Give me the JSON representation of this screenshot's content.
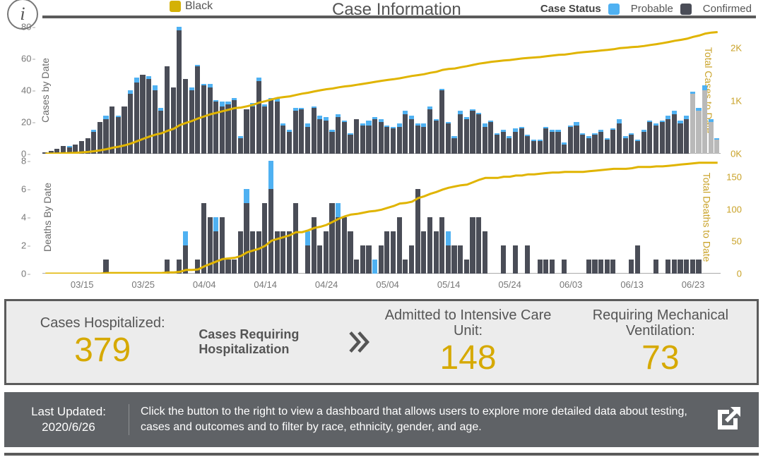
{
  "header": {
    "title": "Case Information",
    "black_label": "Black",
    "status_label": "Case Status",
    "probable": "Probable",
    "confirmed": "Confirmed"
  },
  "hosp": {
    "cases_label": "Cases Hospitalized:",
    "cases_value": "379",
    "note": "Cases Requiring Hospitalization",
    "icu_label": "Admitted to Intensive Care Unit:",
    "icu_value": "148",
    "vent_label": "Requiring Mechanical Ventilation:",
    "vent_value": "73"
  },
  "footer": {
    "lu_label": "Last Updated:",
    "lu_value": "2020/6/26",
    "text": "Click the button to the right to view a dashboard that allows users to explore more detailed data about testing, cases and outcomes and to filter by race, ethnicity, gender, and age."
  },
  "chart_data": [
    {
      "id": "cases",
      "type": "bar+line",
      "left_axis_label": "Cases by Date",
      "right_axis_label": "Total Cases to Date",
      "left_max": 80,
      "left_ticks": [
        0,
        20,
        40,
        60,
        80
      ],
      "right_max": 2400,
      "right_ticks": [
        {
          "v": 0,
          "l": "0K"
        },
        {
          "v": 1000,
          "l": "1K"
        },
        {
          "v": 2000,
          "l": "2K"
        }
      ],
      "x_ticks": [
        "03/15",
        "03/25",
        "04/04",
        "04/14",
        "04/24",
        "05/04",
        "05/14",
        "05/24",
        "06/03",
        "06/13",
        "06/23"
      ],
      "start_date": "2020-03-09",
      "bars": [
        {
          "c": 1,
          "p": 0
        },
        {
          "c": 2,
          "p": 0
        },
        {
          "c": 3,
          "p": 0
        },
        {
          "c": 5,
          "p": 0
        },
        {
          "c": 4,
          "p": 1
        },
        {
          "c": 6,
          "p": 0
        },
        {
          "c": 8,
          "p": 0
        },
        {
          "c": 10,
          "p": 0
        },
        {
          "c": 14,
          "p": 1
        },
        {
          "c": 20,
          "p": 0
        },
        {
          "c": 22,
          "p": 2
        },
        {
          "c": 30,
          "p": 0
        },
        {
          "c": 23,
          "p": 1
        },
        {
          "c": 30,
          "p": 0
        },
        {
          "c": 38,
          "p": 2
        },
        {
          "c": 45,
          "p": 3
        },
        {
          "c": 50,
          "p": 0
        },
        {
          "c": 47,
          "p": 2
        },
        {
          "c": 40,
          "p": 3
        },
        {
          "c": 27,
          "p": 2
        },
        {
          "c": 55,
          "p": 0
        },
        {
          "c": 42,
          "p": 0
        },
        {
          "c": 78,
          "p": 2
        },
        {
          "c": 47,
          "p": 0
        },
        {
          "c": 40,
          "p": 2
        },
        {
          "c": 55,
          "p": 1
        },
        {
          "c": 43,
          "p": 1
        },
        {
          "c": 42,
          "p": 2
        },
        {
          "c": 33,
          "p": 1
        },
        {
          "c": 30,
          "p": 3
        },
        {
          "c": 31,
          "p": 2
        },
        {
          "c": 34,
          "p": 1
        },
        {
          "c": 10,
          "p": 1
        },
        {
          "c": 28,
          "p": 0
        },
        {
          "c": 30,
          "p": 2
        },
        {
          "c": 46,
          "p": 2
        },
        {
          "c": 30,
          "p": 1
        },
        {
          "c": 34,
          "p": 1
        },
        {
          "c": 33,
          "p": 2
        },
        {
          "c": 18,
          "p": 1
        },
        {
          "c": 14,
          "p": 1
        },
        {
          "c": 27,
          "p": 2
        },
        {
          "c": 28,
          "p": 1
        },
        {
          "c": 17,
          "p": 2
        },
        {
          "c": 29,
          "p": 1
        },
        {
          "c": 22,
          "p": 2
        },
        {
          "c": 21,
          "p": 2
        },
        {
          "c": 14,
          "p": 1
        },
        {
          "c": 23,
          "p": 2
        },
        {
          "c": 20,
          "p": 1
        },
        {
          "c": 12,
          "p": 1
        },
        {
          "c": 22,
          "p": 0
        },
        {
          "c": 18,
          "p": 1
        },
        {
          "c": 18,
          "p": 3
        },
        {
          "c": 22,
          "p": 1
        },
        {
          "c": 20,
          "p": 2
        },
        {
          "c": 17,
          "p": 1
        },
        {
          "c": 16,
          "p": 1
        },
        {
          "c": 17,
          "p": 2
        },
        {
          "c": 25,
          "p": 2
        },
        {
          "c": 22,
          "p": 2
        },
        {
          "c": 18,
          "p": 1
        },
        {
          "c": 17,
          "p": 2
        },
        {
          "c": 28,
          "p": 2
        },
        {
          "c": 21,
          "p": 1
        },
        {
          "c": 40,
          "p": 1
        },
        {
          "c": 19,
          "p": 1
        },
        {
          "c": 10,
          "p": 1
        },
        {
          "c": 25,
          "p": 2
        },
        {
          "c": 22,
          "p": 1
        },
        {
          "c": 27,
          "p": 1
        },
        {
          "c": 25,
          "p": 1
        },
        {
          "c": 17,
          "p": 2
        },
        {
          "c": 20,
          "p": 1
        },
        {
          "c": 12,
          "p": 1
        },
        {
          "c": 14,
          "p": 1
        },
        {
          "c": 10,
          "p": 1
        },
        {
          "c": 14,
          "p": 2
        },
        {
          "c": 16,
          "p": 1
        },
        {
          "c": 11,
          "p": 1
        },
        {
          "c": 8,
          "p": 1
        },
        {
          "c": 8,
          "p": 1
        },
        {
          "c": 16,
          "p": 1
        },
        {
          "c": 14,
          "p": 1
        },
        {
          "c": 14,
          "p": 1
        },
        {
          "c": 6,
          "p": 1
        },
        {
          "c": 17,
          "p": 1
        },
        {
          "c": 18,
          "p": 2
        },
        {
          "c": 12,
          "p": 1
        },
        {
          "c": 10,
          "p": 1
        },
        {
          "c": 12,
          "p": 1
        },
        {
          "c": 14,
          "p": 1
        },
        {
          "c": 9,
          "p": 1
        },
        {
          "c": 15,
          "p": 1
        },
        {
          "c": 19,
          "p": 3
        },
        {
          "c": 10,
          "p": 1
        },
        {
          "c": 12,
          "p": 1
        },
        {
          "c": 8,
          "p": 1
        },
        {
          "c": 14,
          "p": 1
        },
        {
          "c": 20,
          "p": 1
        },
        {
          "c": 18,
          "p": 1
        },
        {
          "c": 20,
          "p": 1
        },
        {
          "c": 22,
          "p": 2
        },
        {
          "c": 25,
          "p": 2
        },
        {
          "c": 19,
          "p": 2
        },
        {
          "c": 22,
          "p": 2
        },
        {
          "c": 38,
          "p": 1,
          "grey": true
        },
        {
          "c": 27,
          "p": 2,
          "grey": true
        },
        {
          "c": 40,
          "p": 3,
          "grey": true
        },
        {
          "c": 20,
          "p": 2,
          "grey": true
        },
        {
          "c": 9,
          "p": 1,
          "grey": true
        }
      ],
      "cumulative_end": 2300
    },
    {
      "id": "deaths",
      "type": "bar+line",
      "left_axis_label": "Deaths By Date",
      "right_axis_label": "Total Deaths to Date",
      "left_max": 8,
      "left_ticks": [
        0,
        2,
        4,
        6,
        8
      ],
      "right_max": 175,
      "right_ticks": [
        {
          "v": 0,
          "l": "0"
        },
        {
          "v": 50,
          "l": "50"
        },
        {
          "v": 100,
          "l": "100"
        },
        {
          "v": 150,
          "l": "150"
        }
      ],
      "start_date": "2020-03-09",
      "bars": [
        {
          "c": 0,
          "p": 0
        },
        {
          "c": 0,
          "p": 0
        },
        {
          "c": 0,
          "p": 0
        },
        {
          "c": 0,
          "p": 0
        },
        {
          "c": 0,
          "p": 0
        },
        {
          "c": 0,
          "p": 0
        },
        {
          "c": 0,
          "p": 0
        },
        {
          "c": 0,
          "p": 0
        },
        {
          "c": 0,
          "p": 0
        },
        {
          "c": 0,
          "p": 0
        },
        {
          "c": 1,
          "p": 0
        },
        {
          "c": 0,
          "p": 0
        },
        {
          "c": 0,
          "p": 0
        },
        {
          "c": 0,
          "p": 0
        },
        {
          "c": 0,
          "p": 0
        },
        {
          "c": 0,
          "p": 0
        },
        {
          "c": 0,
          "p": 0
        },
        {
          "c": 0,
          "p": 0
        },
        {
          "c": 0,
          "p": 0
        },
        {
          "c": 0,
          "p": 0
        },
        {
          "c": 1,
          "p": 0
        },
        {
          "c": 0,
          "p": 0
        },
        {
          "c": 1,
          "p": 0
        },
        {
          "c": 2,
          "p": 1
        },
        {
          "c": 0,
          "p": 0
        },
        {
          "c": 1,
          "p": 0
        },
        {
          "c": 5,
          "p": 0
        },
        {
          "c": 4,
          "p": 0
        },
        {
          "c": 3,
          "p": 1
        },
        {
          "c": 4,
          "p": 0
        },
        {
          "c": 1,
          "p": 0
        },
        {
          "c": 1,
          "p": 0
        },
        {
          "c": 3,
          "p": 0
        },
        {
          "c": 5,
          "p": 1
        },
        {
          "c": 3,
          "p": 0
        },
        {
          "c": 3,
          "p": 0
        },
        {
          "c": 5,
          "p": 0
        },
        {
          "c": 6,
          "p": 2
        },
        {
          "c": 3,
          "p": 0
        },
        {
          "c": 3,
          "p": 0
        },
        {
          "c": 3,
          "p": 0
        },
        {
          "c": 5,
          "p": 0
        },
        {
          "c": 0,
          "p": 0
        },
        {
          "c": 2,
          "p": 1
        },
        {
          "c": 4,
          "p": 0
        },
        {
          "c": 2,
          "p": 0
        },
        {
          "c": 3,
          "p": 0
        },
        {
          "c": 5,
          "p": 0
        },
        {
          "c": 4,
          "p": 1
        },
        {
          "c": 4,
          "p": 0
        },
        {
          "c": 3,
          "p": 0
        },
        {
          "c": 1,
          "p": 0
        },
        {
          "c": 2,
          "p": 0
        },
        {
          "c": 2,
          "p": 0
        },
        {
          "c": 0,
          "p": 1
        },
        {
          "c": 2,
          "p": 0
        },
        {
          "c": 3,
          "p": 0
        },
        {
          "c": 3,
          "p": 0
        },
        {
          "c": 4,
          "p": 0
        },
        {
          "c": 1,
          "p": 0
        },
        {
          "c": 2,
          "p": 0
        },
        {
          "c": 6,
          "p": 0
        },
        {
          "c": 3,
          "p": 0
        },
        {
          "c": 4,
          "p": 0
        },
        {
          "c": 3,
          "p": 0
        },
        {
          "c": 4,
          "p": 0
        },
        {
          "c": 2,
          "p": 1
        },
        {
          "c": 2,
          "p": 0
        },
        {
          "c": 2,
          "p": 0
        },
        {
          "c": 1,
          "p": 0
        },
        {
          "c": 4,
          "p": 0
        },
        {
          "c": 4,
          "p": 0
        },
        {
          "c": 3,
          "p": 0
        },
        {
          "c": 0,
          "p": 0
        },
        {
          "c": 0,
          "p": 0
        },
        {
          "c": 2,
          "p": 0
        },
        {
          "c": 0,
          "p": 0
        },
        {
          "c": 2,
          "p": 0
        },
        {
          "c": 0,
          "p": 0
        },
        {
          "c": 2,
          "p": 0
        },
        {
          "c": 0,
          "p": 0
        },
        {
          "c": 1,
          "p": 0
        },
        {
          "c": 1,
          "p": 0
        },
        {
          "c": 1,
          "p": 0
        },
        {
          "c": 0,
          "p": 0
        },
        {
          "c": 1,
          "p": 0
        },
        {
          "c": 0,
          "p": 0
        },
        {
          "c": 0,
          "p": 0
        },
        {
          "c": 0,
          "p": 0
        },
        {
          "c": 1,
          "p": 0
        },
        {
          "c": 1,
          "p": 0
        },
        {
          "c": 1,
          "p": 0
        },
        {
          "c": 1,
          "p": 0
        },
        {
          "c": 1,
          "p": 0
        },
        {
          "c": 0,
          "p": 0
        },
        {
          "c": 0,
          "p": 0
        },
        {
          "c": 1,
          "p": 0
        },
        {
          "c": 2,
          "p": 0
        },
        {
          "c": 0,
          "p": 0
        },
        {
          "c": 0,
          "p": 0
        },
        {
          "c": 1,
          "p": 0
        },
        {
          "c": 0,
          "p": 0
        },
        {
          "c": 1,
          "p": 0
        },
        {
          "c": 1,
          "p": 0
        },
        {
          "c": 1,
          "p": 0
        },
        {
          "c": 1,
          "p": 0
        },
        {
          "c": 1,
          "p": 0
        },
        {
          "c": 1,
          "p": 0
        },
        {
          "c": 0,
          "p": 0
        },
        {
          "c": 0,
          "p": 0
        },
        {
          "c": 0,
          "p": 0
        }
      ],
      "cumulative_end": 172
    }
  ]
}
